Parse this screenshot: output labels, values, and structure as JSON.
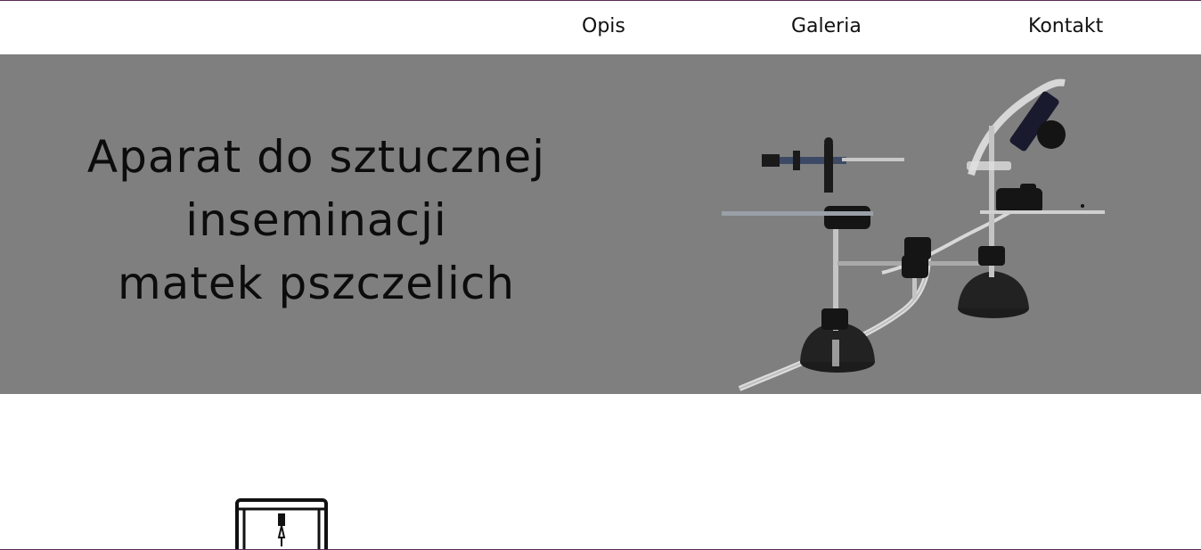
{
  "nav": {
    "items": [
      {
        "label": "Opis"
      },
      {
        "label": "Galeria"
      },
      {
        "label": "Kontakt"
      }
    ]
  },
  "hero": {
    "title_lines": [
      "Aparat do sztucznej",
      "inseminacji",
      "matek pszczelich"
    ],
    "background_color": "#7f7f7f",
    "image_icon": "insemination-apparatus-photo"
  },
  "feature": {
    "icon": "3d-printer-icon"
  },
  "colors": {
    "border": "#5a2a5a",
    "text": "#111111",
    "hero_bg": "#7f7f7f"
  }
}
